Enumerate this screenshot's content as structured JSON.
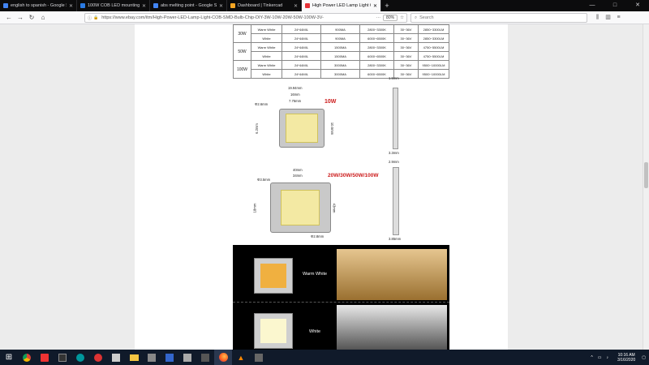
{
  "tabs": [
    {
      "title": "english to spanish - Google Se",
      "color": "#4285f4",
      "active": false
    },
    {
      "title": "100W COB LED mounting pla",
      "color": "#2a7ae2",
      "active": false
    },
    {
      "title": "abs melting point - Google Sea",
      "color": "#4285f4",
      "active": false
    },
    {
      "title": "Dashboard | Tinkercad",
      "color": "#f5a623",
      "active": false
    },
    {
      "title": "High Power LED Lamp Light C",
      "color": "#e53238",
      "active": true
    }
  ],
  "new_tab": "+",
  "window_controls": {
    "minimize": "—",
    "maximize": "□",
    "close": "✕"
  },
  "url": "https://www.ebay.com/itm/High-Power-LED-Lamp-Light-COB-SMD-Bulb-Chip-DIY-3W-10W-20W-50W-100W-3V-",
  "zoom": "80%",
  "search_placeholder": "Search",
  "spec_table": [
    {
      "power": "30W",
      "color": "Warm White",
      "size": "24*44MIL",
      "current": "900MA",
      "cct": "2800~3300K",
      "volt": "30~36V",
      "lm": "2850~3300LM"
    },
    {
      "power": "",
      "color": "White",
      "size": "24*44MIL",
      "current": "900MA",
      "cct": "6000~6500K",
      "volt": "30~36V",
      "lm": "2850~3300LM"
    },
    {
      "power": "50W",
      "color": "Warm White",
      "size": "24*44MIL",
      "current": "1500MA",
      "cct": "2800~3300K",
      "volt": "30~36V",
      "lm": "4750~5500LM"
    },
    {
      "power": "",
      "color": "White",
      "size": "24*44MIL",
      "current": "1500MA",
      "cct": "6000~6500K",
      "volt": "30~36V",
      "lm": "4750~5500LM"
    },
    {
      "power": "100W",
      "color": "Warm White",
      "size": "24*44MIL",
      "current": "3000MA",
      "cct": "2800~3300K",
      "volt": "30~36V",
      "lm": "9500~10000LM"
    },
    {
      "power": "",
      "color": "White",
      "size": "24*44MIL",
      "current": "3000MA",
      "cct": "6000~6500K",
      "volt": "30~36V",
      "lm": "9500~10000LM"
    }
  ],
  "diagram": {
    "w10_label": "10W",
    "w10_dims": [
      "19.94mm",
      "16mm",
      "7.75mm",
      "Φ2.6mm",
      "6.2mm",
      "10.5mm"
    ],
    "w10_side": [
      "1.5mm",
      "3.3mm"
    ],
    "w100_label": "20W/30W/50W/100W",
    "w100_dims": [
      "40mm",
      "34mm",
      "Φ3.5mm",
      "18mm",
      "43mm",
      "Φ2.8mm"
    ],
    "w100_side": [
      "2.9mm",
      "3.85mm"
    ]
  },
  "photos": {
    "warm_label": "Warm White",
    "white_label": "White"
  },
  "clock": {
    "time": "10:16 AM",
    "date": "3/16/2020"
  }
}
